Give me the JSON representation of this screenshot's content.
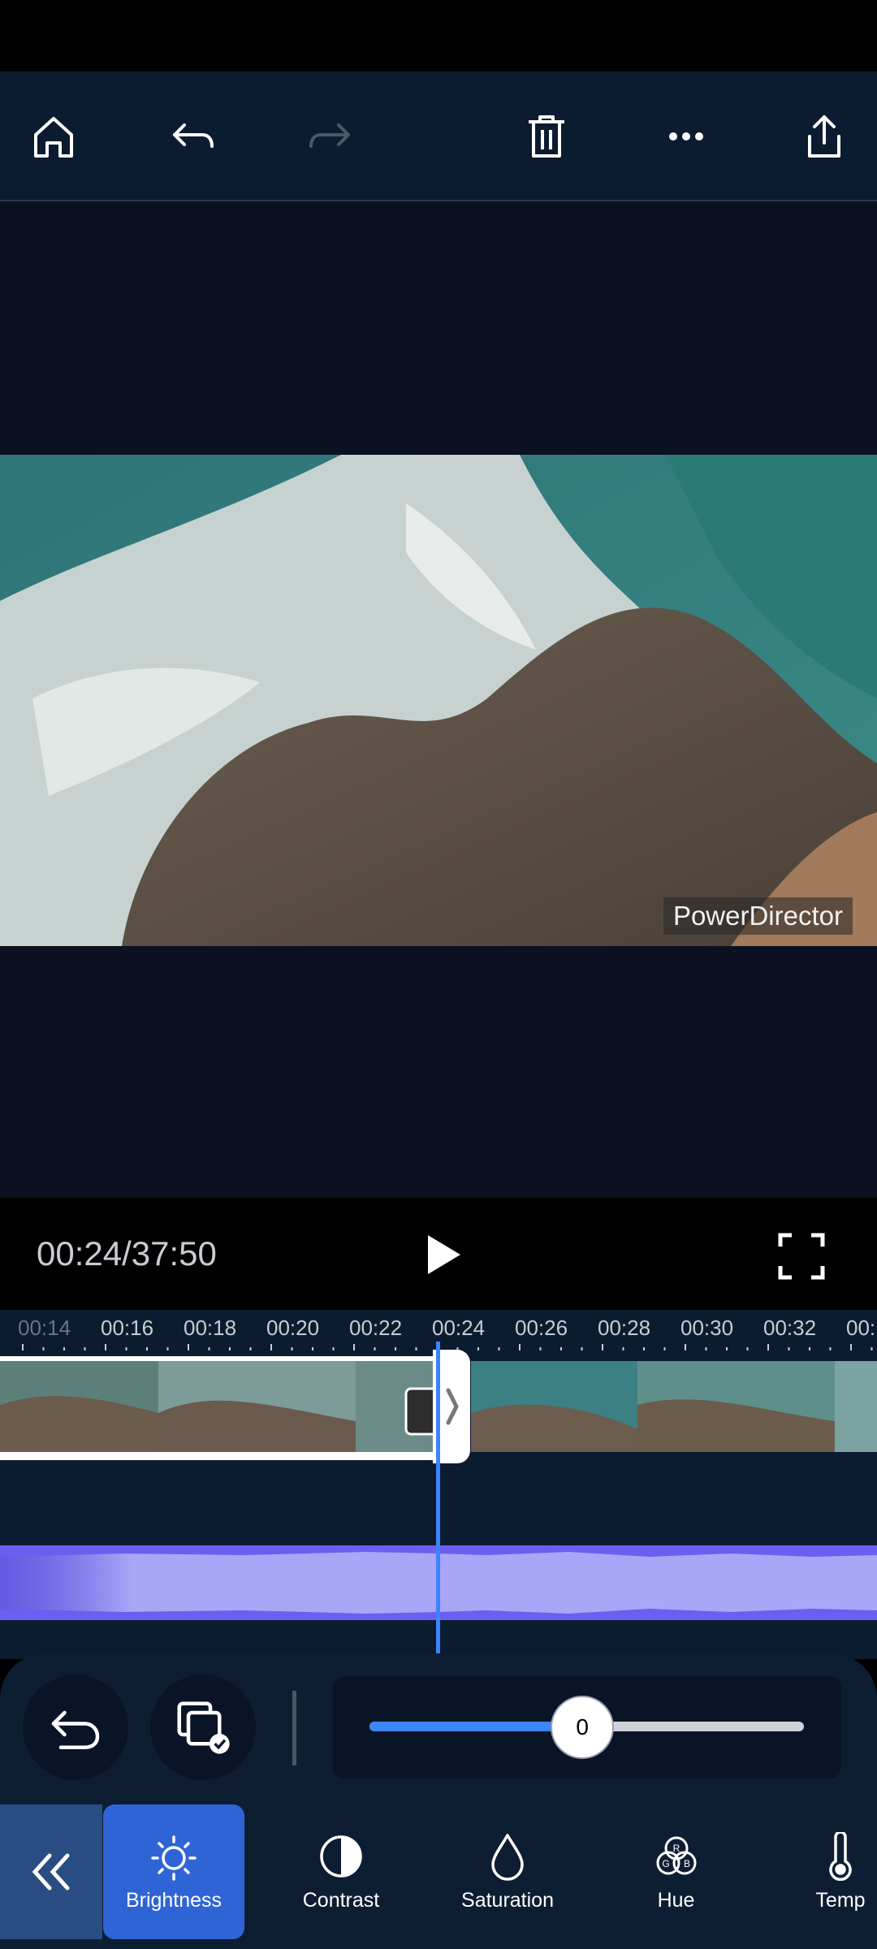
{
  "app": {
    "watermark": "PowerDirector"
  },
  "toolbar": {
    "icons": [
      "home-icon",
      "undo-icon",
      "redo-icon",
      "trash-icon",
      "more-icon",
      "share-icon"
    ],
    "redo_enabled": false
  },
  "player": {
    "timecode": "00:24/37:50"
  },
  "timeline": {
    "ticks": [
      "00:14",
      "00:16",
      "00:18",
      "00:20",
      "00:22",
      "00:24",
      "00:26",
      "00:28",
      "00:30",
      "00:32",
      "00:"
    ]
  },
  "adjust": {
    "slider_value": "0",
    "slider_fraction": 0.49
  },
  "tools": [
    {
      "label": "Brightness",
      "icon": "sun-icon",
      "active": true
    },
    {
      "label": "Contrast",
      "icon": "contrast-icon",
      "active": false
    },
    {
      "label": "Saturation",
      "icon": "drop-icon",
      "active": false
    },
    {
      "label": "Hue",
      "icon": "rgb-icon",
      "active": false
    },
    {
      "label": "Temp",
      "icon": "thermometer-icon",
      "active": false
    }
  ],
  "colors": {
    "accent": "#3c84ff",
    "toolbar_bg": "#0c1c30",
    "audio_wave": "#a9a6f7"
  }
}
